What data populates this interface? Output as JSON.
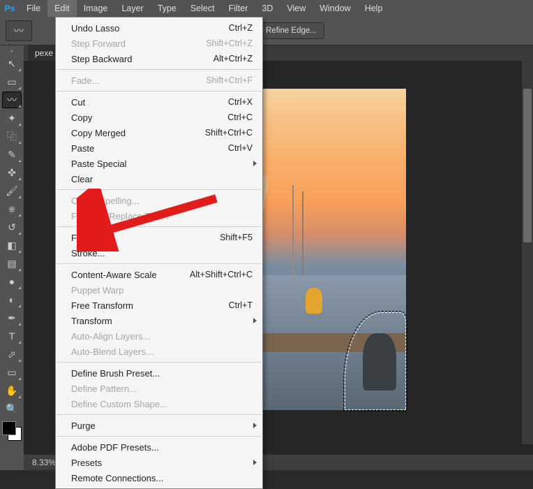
{
  "app_name": "Ps",
  "menu": [
    "File",
    "Edit",
    "Image",
    "Layer",
    "Type",
    "Select",
    "Filter",
    "3D",
    "View",
    "Window",
    "Help"
  ],
  "active_menu_index": 1,
  "options_bar": {
    "refine_edge": "Refine Edge..."
  },
  "doc_tab": "pexe",
  "status": {
    "zoom": "8.33%"
  },
  "tools": [
    {
      "name": "move-tool",
      "glyph": "↖",
      "hasSubmenu": true
    },
    {
      "name": "rect-marquee-tool",
      "glyph": "▭",
      "hasSubmenu": true
    },
    {
      "name": "lasso-tool",
      "glyph": "〰",
      "hasSubmenu": true,
      "selected": true
    },
    {
      "name": "magic-wand-tool",
      "glyph": "✦",
      "hasSubmenu": true
    },
    {
      "name": "crop-tool",
      "glyph": "⿻",
      "hasSubmenu": true
    },
    {
      "name": "eyedropper-tool",
      "glyph": "✎",
      "hasSubmenu": true
    },
    {
      "name": "healing-brush-tool",
      "glyph": "✜",
      "hasSubmenu": true
    },
    {
      "name": "brush-tool",
      "glyph": "🖌",
      "hasSubmenu": true
    },
    {
      "name": "clone-stamp-tool",
      "glyph": "⎈",
      "hasSubmenu": true
    },
    {
      "name": "history-brush-tool",
      "glyph": "↺",
      "hasSubmenu": true
    },
    {
      "name": "eraser-tool",
      "glyph": "◧",
      "hasSubmenu": true
    },
    {
      "name": "gradient-tool",
      "glyph": "▤",
      "hasSubmenu": true
    },
    {
      "name": "blur-tool",
      "glyph": "●",
      "hasSubmenu": true
    },
    {
      "name": "dodge-tool",
      "glyph": "◐",
      "hasSubmenu": true
    },
    {
      "name": "pen-tool",
      "glyph": "✒",
      "hasSubmenu": true
    },
    {
      "name": "type-tool",
      "glyph": "T",
      "hasSubmenu": true
    },
    {
      "name": "path-select-tool",
      "glyph": "⬀",
      "hasSubmenu": true
    },
    {
      "name": "shape-tool",
      "glyph": "▭",
      "hasSubmenu": true
    },
    {
      "name": "hand-tool",
      "glyph": "✋",
      "hasSubmenu": true
    },
    {
      "name": "zoom-tool",
      "glyph": "🔍",
      "hasSubmenu": false
    }
  ],
  "edit_menu": [
    {
      "type": "item",
      "label": "Undo Lasso",
      "shortcut": "Ctrl+Z"
    },
    {
      "type": "item",
      "label": "Step Forward",
      "shortcut": "Shift+Ctrl+Z",
      "disabled": true
    },
    {
      "type": "item",
      "label": "Step Backward",
      "shortcut": "Alt+Ctrl+Z"
    },
    {
      "type": "sep"
    },
    {
      "type": "item",
      "label": "Fade...",
      "shortcut": "Shift+Ctrl+F",
      "disabled": true
    },
    {
      "type": "sep"
    },
    {
      "type": "item",
      "label": "Cut",
      "shortcut": "Ctrl+X"
    },
    {
      "type": "item",
      "label": "Copy",
      "shortcut": "Ctrl+C"
    },
    {
      "type": "item",
      "label": "Copy Merged",
      "shortcut": "Shift+Ctrl+C"
    },
    {
      "type": "item",
      "label": "Paste",
      "shortcut": "Ctrl+V"
    },
    {
      "type": "item",
      "label": "Paste Special",
      "submenu": true
    },
    {
      "type": "item",
      "label": "Clear"
    },
    {
      "type": "sep"
    },
    {
      "type": "item",
      "label": "Check Spelling...",
      "disabled": true
    },
    {
      "type": "item",
      "label": "Find and Replace Text...",
      "disabled": true
    },
    {
      "type": "sep"
    },
    {
      "type": "item",
      "label": "Fill...",
      "shortcut": "Shift+F5"
    },
    {
      "type": "item",
      "label": "Stroke..."
    },
    {
      "type": "sep"
    },
    {
      "type": "item",
      "label": "Content-Aware Scale",
      "shortcut": "Alt+Shift+Ctrl+C"
    },
    {
      "type": "item",
      "label": "Puppet Warp",
      "disabled": true
    },
    {
      "type": "item",
      "label": "Free Transform",
      "shortcut": "Ctrl+T"
    },
    {
      "type": "item",
      "label": "Transform",
      "submenu": true
    },
    {
      "type": "item",
      "label": "Auto-Align Layers...",
      "disabled": true
    },
    {
      "type": "item",
      "label": "Auto-Blend Layers...",
      "disabled": true
    },
    {
      "type": "sep"
    },
    {
      "type": "item",
      "label": "Define Brush Preset..."
    },
    {
      "type": "item",
      "label": "Define Pattern...",
      "disabled": true
    },
    {
      "type": "item",
      "label": "Define Custom Shape...",
      "disabled": true
    },
    {
      "type": "sep"
    },
    {
      "type": "item",
      "label": "Purge",
      "submenu": true
    },
    {
      "type": "sep"
    },
    {
      "type": "item",
      "label": "Adobe PDF Presets..."
    },
    {
      "type": "item",
      "label": "Presets",
      "submenu": true
    },
    {
      "type": "item",
      "label": "Remote Connections..."
    }
  ]
}
